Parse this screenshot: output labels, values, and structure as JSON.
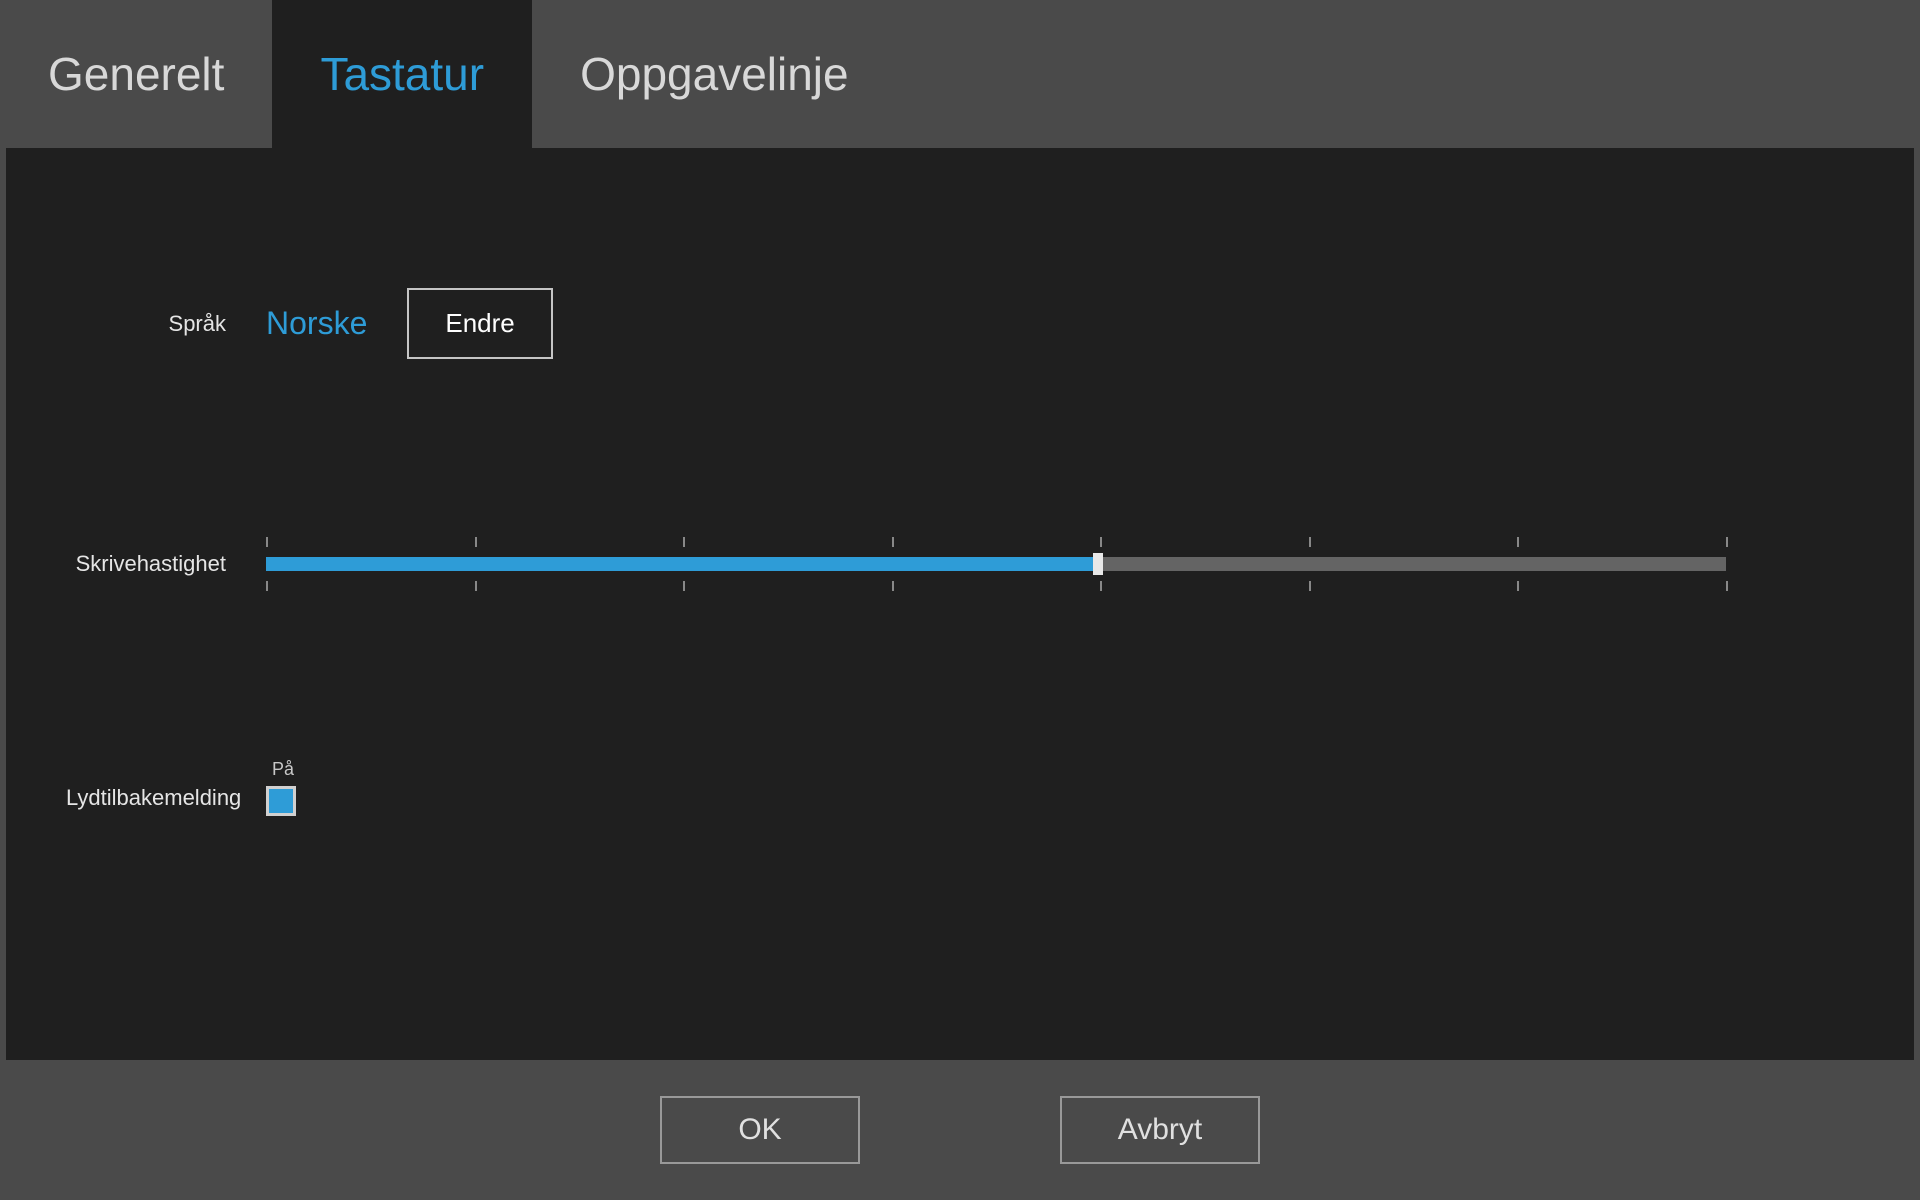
{
  "tabs": {
    "general": "Generelt",
    "keyboard": "Tastatur",
    "taskbar": "Oppgavelinje"
  },
  "language": {
    "label": "Språk",
    "value": "Norske",
    "change_button": "Endre"
  },
  "typing_speed": {
    "label": "Skrivehastighet",
    "value_percent": 57,
    "ticks": 8
  },
  "audio_feedback": {
    "label": "Lydtilbakemelding",
    "status": "På",
    "enabled": true
  },
  "footer": {
    "ok": "OK",
    "cancel": "Avbryt"
  },
  "colors": {
    "accent": "#2e9cd7",
    "background_dark": "#1f1f1f",
    "background_outer": "#4a4a4a"
  }
}
